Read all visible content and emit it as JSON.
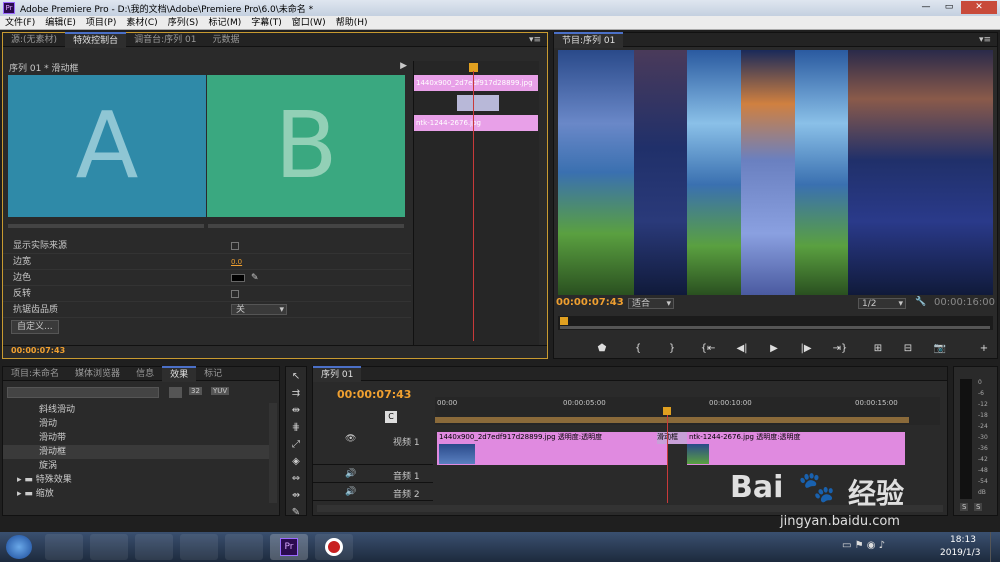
{
  "window": {
    "title": "Adobe Premiere Pro - D:\\我的文档\\Adobe\\Premiere Pro\\6.0\\未命名 *"
  },
  "menu": [
    "文件(F)",
    "编辑(E)",
    "项目(P)",
    "素材(C)",
    "序列(S)",
    "标记(M)",
    "字幕(T)",
    "窗口(W)",
    "帮助(H)"
  ],
  "source_panel": {
    "tabs": [
      "源:(无素材)",
      "特效控制台",
      "调音台:序列 01",
      "元数据"
    ],
    "header": "序列 01 * 滑动框",
    "preview_a": "A",
    "preview_b": "B",
    "clip1": "1440x900_2d7edf917d28899.jpg",
    "clip2": "ntk-1244-2676.jpg",
    "props": [
      {
        "label": "显示实际来源"
      },
      {
        "label": "边宽",
        "value": "0.0"
      },
      {
        "label": "边色"
      },
      {
        "label": "反转"
      },
      {
        "label": "抗锯齿品质",
        "value": "关"
      }
    ],
    "custom_btn": "自定义...",
    "timecode": "00:00:07:43"
  },
  "program": {
    "tab": "节目:序列 01",
    "timecode": "00:00:07:43",
    "fit": "适合",
    "scale": "1/2",
    "duration": "00:00:16:00"
  },
  "project": {
    "tabs": [
      "项目:未命名",
      "媒体浏览器",
      "信息",
      "效果",
      "标记"
    ],
    "items": [
      "斜线滑动",
      "滑动",
      "滑动带",
      "滑动框",
      "旋涡"
    ],
    "folders": [
      "特殊效果",
      "缩放"
    ],
    "badges": [
      "32",
      "YUV"
    ]
  },
  "timeline": {
    "tab": "序列 01",
    "timecode": "00:00:07:43",
    "ruler": [
      "00:00",
      "00:00:05:00",
      "00:00:10:00",
      "00:00:15:00"
    ],
    "tracks": {
      "video1": "视频 1",
      "audio1": "音频 1",
      "audio2": "音频 2"
    },
    "clip1": "1440x900_2d7edf917d28899.jpg 透明度:透明度",
    "transition": "滑动框",
    "clip2": "ntk-1244-2676.jpg 透明度:透明度"
  },
  "audio_meter": {
    "scale": [
      "0",
      "-6",
      "-12",
      "-18",
      "-24",
      "-30",
      "-36",
      "-42",
      "-48",
      "-54",
      "dB"
    ],
    "solo": [
      "S",
      "S"
    ]
  },
  "watermark": {
    "main": "Bai",
    "sub": "经验",
    "url": "jingyan.baidu.com"
  },
  "taskbar": {
    "time": "18:13",
    "date": "2019/1/3"
  }
}
